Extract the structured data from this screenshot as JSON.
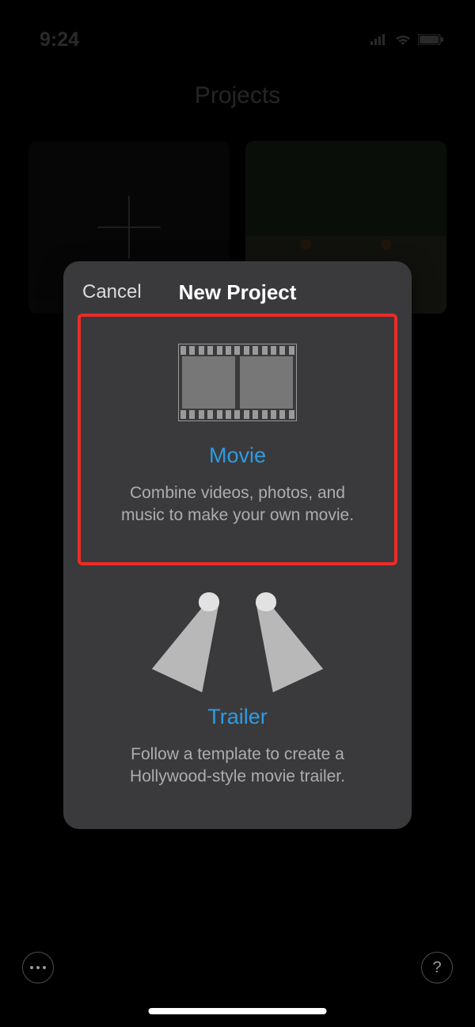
{
  "status": {
    "time": "9:24"
  },
  "page": {
    "title": "Projects"
  },
  "modal": {
    "cancel_label": "Cancel",
    "title": "New Project",
    "movie": {
      "title": "Movie",
      "desc": "Combine videos, photos, and music to make your own movie."
    },
    "trailer": {
      "title": "Trailer",
      "desc": "Follow a template to create a Hollywood-style movie trailer."
    }
  }
}
